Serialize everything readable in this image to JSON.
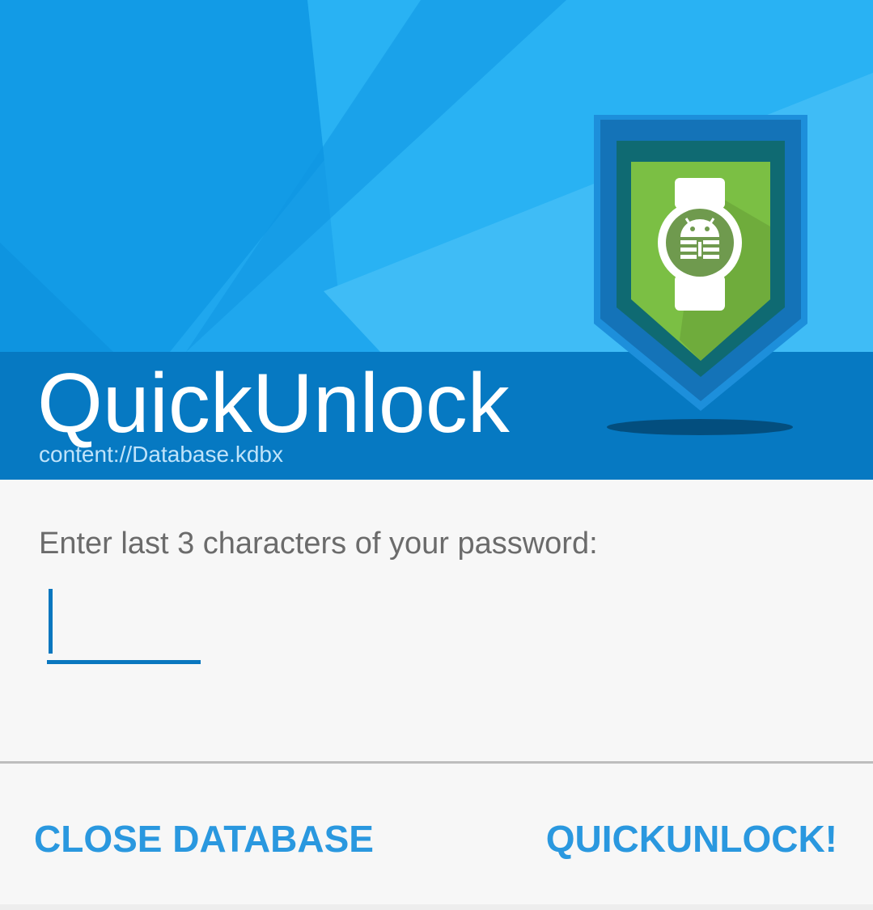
{
  "header": {
    "title": "QuickUnlock",
    "database_path": "content://Database.kdbx",
    "logo_icon": "keepass-watch-shield-icon"
  },
  "form": {
    "prompt": "Enter last 3 characters of your password:",
    "input_value": ""
  },
  "actions": {
    "close_label": "CLOSE DATABASE",
    "unlock_label": "QUICKUNLOCK!"
  },
  "colors": {
    "header_bg": "#1aa6ee",
    "title_band": "#0679c2",
    "accent": "#2a98df",
    "input_underline": "#0a77bf"
  }
}
